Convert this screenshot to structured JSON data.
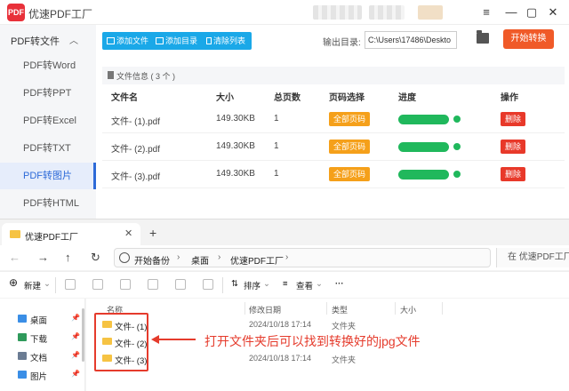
{
  "app": {
    "logo_text": "PDF",
    "title": "优速PDF工厂",
    "window_controls": [
      "menu-icon",
      "minimize-icon",
      "maximize-icon",
      "close-icon"
    ]
  },
  "sidebar": {
    "section": "PDF转文件",
    "items": [
      {
        "label": "PDF转Word"
      },
      {
        "label": "PDF转PPT"
      },
      {
        "label": "PDF转Excel"
      },
      {
        "label": "PDF转TXT"
      },
      {
        "label": "PDF转图片",
        "active": true
      },
      {
        "label": "PDF转HTML"
      }
    ]
  },
  "toolbar": {
    "add_file": "添加文件",
    "add_dir": "添加目录",
    "clear_list": "清除列表",
    "output_label": "输出目录:",
    "output_path": "C:\\Users\\17486\\Deskto",
    "start": "开始转换"
  },
  "file_info": {
    "label": "文件信息 ( 3 个 )"
  },
  "table": {
    "headers": [
      "文件名",
      "大小",
      "总页数",
      "页码选择",
      "进度",
      "操作"
    ],
    "rows": [
      {
        "name": "文件- (1).pdf",
        "size": "149.30KB",
        "pages": "1",
        "range": "全部页码",
        "progress": 1.0,
        "action": "删除"
      },
      {
        "name": "文件- (2).pdf",
        "size": "149.30KB",
        "pages": "1",
        "range": "全部页码",
        "progress": 1.0,
        "action": "删除"
      },
      {
        "name": "文件- (3).pdf",
        "size": "149.30KB",
        "pages": "1",
        "range": "全部页码",
        "progress": 1.0,
        "action": "删除"
      }
    ]
  },
  "explorer": {
    "tab_label": "优速PDF工厂",
    "breadcrumbs": [
      "开始备份",
      "桌面",
      "优速PDF工厂"
    ],
    "search_placeholder": "在 优速PDF工厂 中",
    "commands": {
      "new": "新建",
      "sort": "排序",
      "view": "查看",
      "more": "···"
    },
    "nav_items": [
      {
        "label": "桌面",
        "color": "#3a8ee6"
      },
      {
        "label": "下载",
        "color": "#2f9a5b"
      },
      {
        "label": "文档",
        "color": "#6b7c93"
      },
      {
        "label": "图片",
        "color": "#3a8ee6"
      }
    ],
    "columns": [
      "名称",
      "修改日期",
      "类型",
      "大小"
    ],
    "files": [
      {
        "name": "文件- (1)",
        "date": "2024/10/18 17:14",
        "type": "文件夹"
      },
      {
        "name": "文件- (2)",
        "date": "",
        "type": ""
      },
      {
        "name": "文件- (3)",
        "date": "2024/10/18 17:14",
        "type": "文件夹"
      }
    ]
  },
  "annotation": "打开文件夹后可以找到转换好的jpg文件",
  "colors": {
    "accent_blue": "#1aa8e8",
    "start_orange": "#f05a28",
    "range_orange": "#f5a01a",
    "progress_green": "#20b85c",
    "delete_red": "#e8392a",
    "annotation_red": "#e53b2c"
  }
}
